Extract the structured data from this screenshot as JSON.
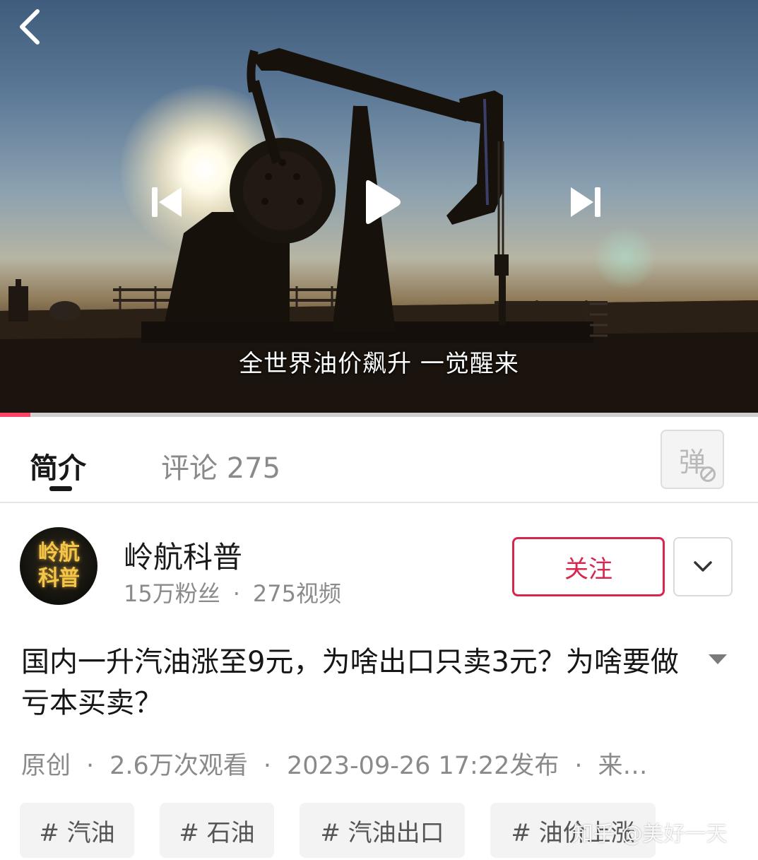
{
  "player": {
    "subtitle": "全世界油价飙升 一觉醒来",
    "progress_fraction": 0.04,
    "accent_color": "#fb4567",
    "icons": [
      "back-chevron-icon",
      "previous-icon",
      "play-icon",
      "next-icon"
    ]
  },
  "tabs": {
    "intro": "简介",
    "comments": "评论 275",
    "danmaku_toggle": "弹"
  },
  "channel": {
    "avatar_line1": "岭航",
    "avatar_line2": "科普",
    "name": "岭航科普",
    "fans": "15万粉丝",
    "dot": "·",
    "videos": "275视频",
    "follow_label": "关注",
    "follow_color": "#d8264f"
  },
  "video": {
    "title": "国内一升汽油涨至9元，为啥出口只卖3元？为啥要做亏本买卖？",
    "meta": {
      "type": "原创",
      "sep": "·",
      "views": "2.6万次观看",
      "published": "2023-09-26 17:22发布",
      "source": "来…"
    }
  },
  "tags": [
    "# 汽油",
    "# 石油",
    "# 汽油出口",
    "# 油价上涨"
  ],
  "watermark": "知乎 @美好一天"
}
